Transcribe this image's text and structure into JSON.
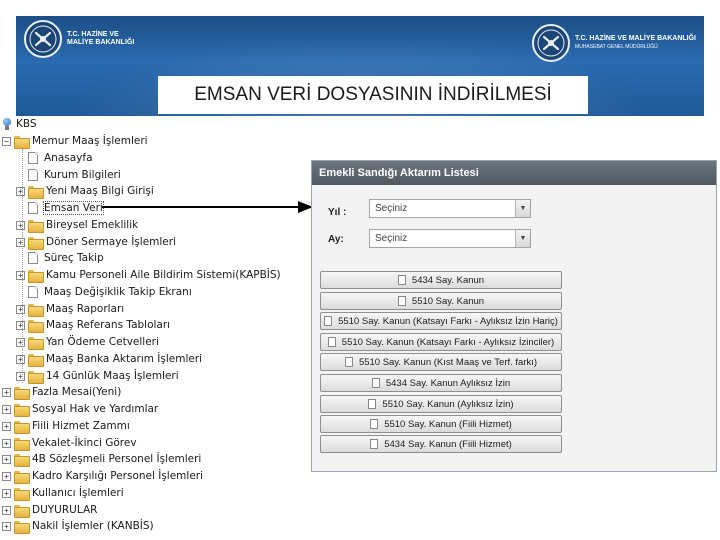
{
  "header": {
    "left_logo_text": [
      "T.C. HAZİNE VE",
      "MALİYE BAKANLIĞI"
    ],
    "right_logo_line1": "T.C. HAZİNE VE MALİYE BAKANLIĞI",
    "right_logo_line2": "MUHASEBAT GENEL MÜDÜRLÜĞÜ",
    "title": "EMSAN VERİ DOSYASININ İNDİRİLMESİ"
  },
  "tree": {
    "root": "KBS",
    "items": [
      {
        "label": "Memur Maaş İşlemleri",
        "icon": "folder-icon",
        "expander": "minus"
      },
      {
        "label": "Anasayfa",
        "icon": "page-icon"
      },
      {
        "label": "Kurum Bilgileri",
        "icon": "page-icon"
      },
      {
        "label": "Yeni Maaş Bilgi Girişi",
        "icon": "folder-icon",
        "expander": "plus"
      },
      {
        "label": "Emsan Veri",
        "icon": "page-icon",
        "selected": true
      },
      {
        "label": "Bireysel Emeklilik",
        "icon": "folder-icon",
        "expander": "plus"
      },
      {
        "label": "Döner Sermaye İşlemleri",
        "icon": "folder-icon",
        "expander": "plus"
      },
      {
        "label": "Süreç Takip",
        "icon": "page-icon"
      },
      {
        "label": "Kamu Personeli Aile Bildirim Sistemi(KAPBİS)",
        "icon": "folder-icon",
        "expander": "plus"
      },
      {
        "label": "Maaş Değişiklik Takip Ekranı",
        "icon": "page-icon"
      },
      {
        "label": "Maaş Raporları",
        "icon": "folder-icon",
        "expander": "plus"
      },
      {
        "label": "Maaş Referans Tabloları",
        "icon": "folder-icon",
        "expander": "plus"
      },
      {
        "label": "Yan Ödeme Cetvelleri",
        "icon": "folder-icon",
        "expander": "plus"
      },
      {
        "label": "Maaş Banka Aktarım İşlemleri",
        "icon": "folder-icon",
        "expander": "plus"
      },
      {
        "label": "14 Günlük Maaş İşlemleri",
        "icon": "folder-icon",
        "expander": "plus"
      },
      {
        "label": "Fazla Mesai(Yeni)",
        "icon": "folder-icon",
        "expander": "plus"
      },
      {
        "label": "Sosyal Hak ve Yardımlar",
        "icon": "folder-icon",
        "expander": "plus"
      },
      {
        "label": "Fiili Hizmet Zammı",
        "icon": "folder-icon",
        "expander": "plus"
      },
      {
        "label": "Vekalet-İkinci Görev",
        "icon": "folder-icon",
        "expander": "plus"
      },
      {
        "label": "4B Sözleşmeli Personel İşlemleri",
        "icon": "folder-icon",
        "expander": "plus"
      },
      {
        "label": "Kadro Karşılığı Personel İşlemleri",
        "icon": "folder-icon",
        "expander": "plus"
      },
      {
        "label": "Kullanıcı İşlemleri",
        "icon": "folder-icon",
        "expander": "plus"
      },
      {
        "label": "DUYURULAR",
        "icon": "folder-icon",
        "expander": "plus"
      },
      {
        "label": "Nakil İşlemler (KANBİS)",
        "icon": "folder-icon",
        "expander": "plus"
      }
    ]
  },
  "panel": {
    "title": "Emekli Sandığı Aktarım Listesi",
    "year_label": "Yıl :",
    "year_value": "Seçiniz",
    "month_label": "Ay:",
    "month_value": "Seçiniz",
    "buttons": [
      "5434 Say. Kanun",
      "5510 Say. Kanun",
      "5510 Say. Kanun (Katsayı Farkı - Aylıksız İzin Hariç)",
      "5510 Say. Kanun (Katsayı Farkı - Aylıksız İzinciler)",
      "5510 Say. Kanun (Kıst Maaş ve Terf. farkı)",
      "5434 Say. Kanun Aylıksız İzin",
      "5510 Say. Kanun (Aylıksız İzin)",
      "5510 Say. Kanun (Fiili Hizmet)",
      "5434 Say. Kanun (Fiili Hizmet)"
    ]
  },
  "colors": {
    "banner": "#1f5a98",
    "panel_header": "#565e66",
    "arrow": "#000000"
  }
}
